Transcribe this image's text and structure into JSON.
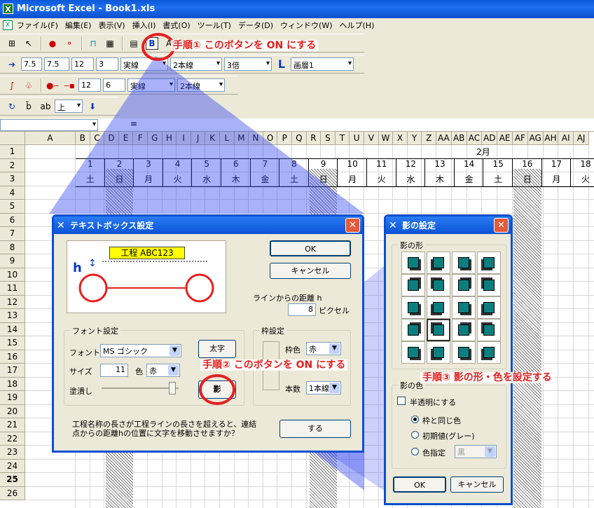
{
  "window": {
    "title": "Microsoft Excel - Book1.xls",
    "app_icon": "excel-icon"
  },
  "menu": [
    "ファイル(F)",
    "編集(E)",
    "表示(V)",
    "挿入(I)",
    "書式(O)",
    "ツール(T)",
    "データ(D)",
    "ウィンドウ(W)",
    "ヘルプ(H)"
  ],
  "toolbar2": {
    "f1": "7.5",
    "f2": "7.5",
    "f3": "12",
    "f4": "3",
    "line_style": "実線",
    "line_count": "2本線",
    "scale": "3倍",
    "layer": "画層1"
  },
  "toolbar3": {
    "f1": "12",
    "f2": "6",
    "line_style": "実線",
    "line_count": "2本線"
  },
  "toolbar4": {
    "position": "上"
  },
  "formula": {
    "eq": "="
  },
  "columns": [
    "A",
    "B",
    "C",
    "D",
    "E",
    "F",
    "G",
    "H",
    "I",
    "J",
    "K",
    "L",
    "M",
    "N",
    "O",
    "P",
    "Q",
    "R",
    "S",
    "T",
    "U",
    "V",
    "W",
    "X",
    "Y",
    "Z",
    "AA",
    "AB",
    "AC",
    "AD",
    "AE",
    "AF",
    "AG",
    "AH",
    "AI",
    "AJ"
  ],
  "rows": [
    "1",
    "2",
    "3",
    "4",
    "5",
    "6",
    "7",
    "8",
    "9",
    "10",
    "11",
    "12",
    "13",
    "14",
    "15",
    "16",
    "17",
    "18",
    "19",
    "20",
    "21",
    "22",
    "23",
    "24",
    "25",
    "26"
  ],
  "calendar": {
    "month": "2月",
    "days": [
      {
        "d": "1",
        "w": "土"
      },
      {
        "d": "2",
        "w": "日"
      },
      {
        "d": "3",
        "w": "月"
      },
      {
        "d": "4",
        "w": "火"
      },
      {
        "d": "5",
        "w": "水"
      },
      {
        "d": "6",
        "w": "木"
      },
      {
        "d": "7",
        "w": "金"
      },
      {
        "d": "8",
        "w": "土"
      },
      {
        "d": "9",
        "w": "日"
      },
      {
        "d": "10",
        "w": "月"
      },
      {
        "d": "11",
        "w": "火"
      },
      {
        "d": "12",
        "w": "水"
      },
      {
        "d": "13",
        "w": "木"
      },
      {
        "d": "14",
        "w": "金"
      },
      {
        "d": "15",
        "w": "土"
      },
      {
        "d": "16",
        "w": "日"
      },
      {
        "d": "17",
        "w": "月"
      },
      {
        "d": "18",
        "w": "火"
      }
    ]
  },
  "textbox_dialog": {
    "title": "テキストボックス設定",
    "preview_label": "工程 ABC123",
    "h_label": "h",
    "ok": "OK",
    "cancel": "キャンセル",
    "distance_label": "ラインからの距離 h",
    "distance_value": "8",
    "distance_unit": "ピクセル",
    "font_group": "フォント設定",
    "font_label": "フォント",
    "font_value": "MS ゴシック",
    "size_label": "サイズ",
    "size_value": "11",
    "color_label": "色",
    "color_value": "赤",
    "fill_label": "塗潰し",
    "bold_button": "太字",
    "shadow_button": "影",
    "frame_group": "枠設定",
    "frame_color_label": "枠色",
    "frame_color_value": "赤",
    "frame_count_label": "本数",
    "frame_count_value": "1本線",
    "question": "工程名称の長さが工程ラインの長さを超えると、連結点からの距離hの位置に文字を移動させますか？",
    "do_button": "する"
  },
  "shadow_dialog": {
    "title": "影の設定",
    "shape_group": "影の形",
    "color_group": "影の色",
    "translucent": "半透明にする",
    "opt_same": "枠と同じ色",
    "opt_default": "初期値(グレー)",
    "opt_specify": "色指定",
    "specify_value": "黒",
    "ok": "OK",
    "cancel": "キャンセル"
  },
  "annotations": {
    "step1": "手順① このボタンを ON にする",
    "step2": "手順② このボタンを ON にする",
    "step3": "手順③ 影の形・色を設定する"
  },
  "colors": {
    "accent_red": "#e52020",
    "title_blue": "#0a52d6",
    "teal": "#0b7f7f"
  }
}
